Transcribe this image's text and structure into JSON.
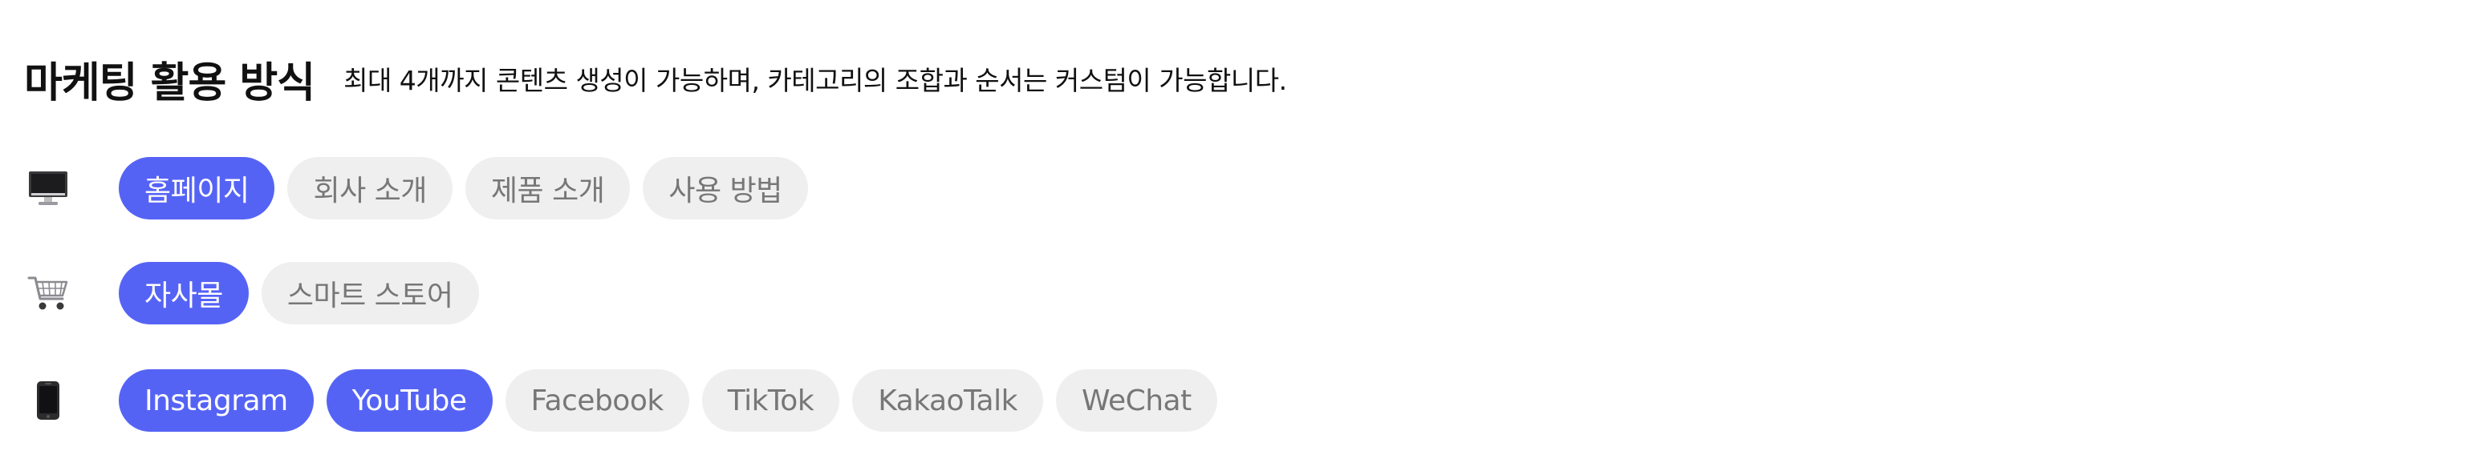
{
  "header": {
    "title": "마케팅 활용 방식",
    "subtitle": "최대 4개까지 콘텐츠 생성이 가능하며, 카테고리의 조합과 순서는 커스텀이 가능합니다."
  },
  "colors": {
    "selected_bg": "#5563f5",
    "selected_text": "#ffffff",
    "unselected_bg": "#efefef",
    "unselected_text": "#777777"
  },
  "rows": [
    {
      "icon": "desktop-computer-icon",
      "chips": [
        {
          "label": "홈페이지",
          "selected": true
        },
        {
          "label": "회사 소개",
          "selected": false
        },
        {
          "label": "제품 소개",
          "selected": false
        },
        {
          "label": "사용 방법",
          "selected": false
        }
      ]
    },
    {
      "icon": "shopping-cart-icon",
      "chips": [
        {
          "label": "자사몰",
          "selected": true
        },
        {
          "label": "스마트 스토어",
          "selected": false
        }
      ]
    },
    {
      "icon": "mobile-phone-icon",
      "chips": [
        {
          "label": "Instagram",
          "selected": true
        },
        {
          "label": "YouTube",
          "selected": true
        },
        {
          "label": "Facebook",
          "selected": false
        },
        {
          "label": "TikTok",
          "selected": false
        },
        {
          "label": "KakaoTalk",
          "selected": false
        },
        {
          "label": "WeChat",
          "selected": false
        }
      ]
    }
  ]
}
